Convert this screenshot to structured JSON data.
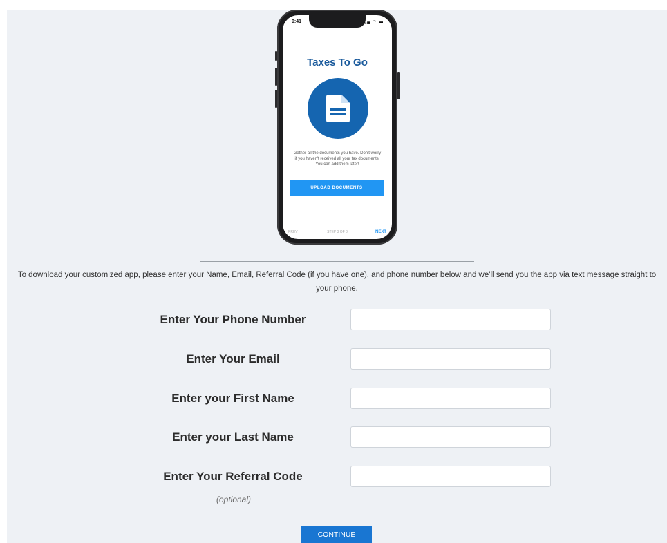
{
  "phone": {
    "status_time": "9:41",
    "app_title": "Taxes To Go",
    "icon": "document-icon",
    "description": "Gather all the documents you have. Don't worry if you haven't received all your tax documents. You can add them later!",
    "upload_label": "UPLOAD DOCUMENTS",
    "prev_label": "PREV",
    "step_label": "STEP 3 OF 8",
    "next_label": "NEXT",
    "accent": "#1565b0"
  },
  "intro_text": "To download your customized app, please enter your Name, Email, Referral Code (if you have one), and phone number below and we'll send you the app via text message straight to your phone.",
  "form": {
    "phone_label": "Enter Your Phone Number",
    "phone_value": "",
    "email_label": "Enter Your Email",
    "email_value": "",
    "first_name_label": "Enter your First Name",
    "first_name_value": "",
    "last_name_label": "Enter your Last Name",
    "last_name_value": "",
    "referral_label": "Enter Your Referral Code",
    "referral_value": "",
    "optional_note": "(optional)",
    "continue_label": "CONTINUE"
  },
  "colors": {
    "background": "#eef1f5",
    "button": "#1976d2"
  }
}
